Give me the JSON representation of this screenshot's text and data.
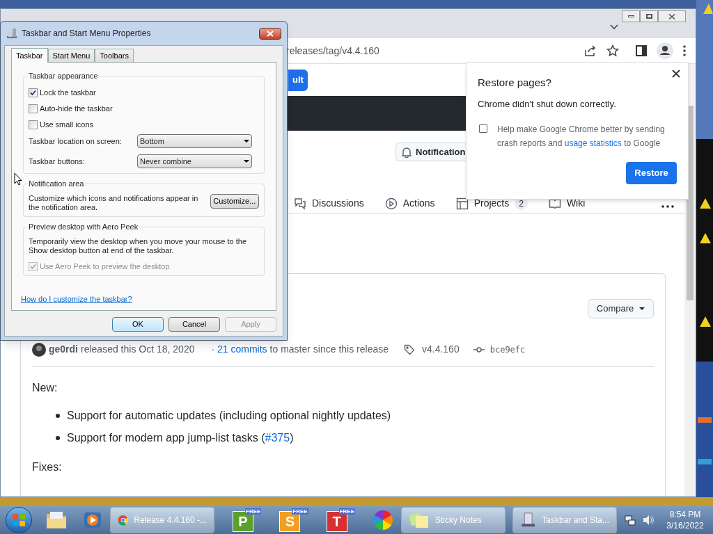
{
  "browser": {
    "address": "releases/tag/v4.4.160",
    "page": {
      "partial_button": "ult",
      "notification_button": "Notification",
      "nav": [
        {
          "label": "Discussions",
          "kind": "discussions"
        },
        {
          "label": "Actions",
          "kind": "actions"
        },
        {
          "label": "Projects",
          "kind": "projects",
          "count": "2"
        },
        {
          "label": "Wiki",
          "kind": "wiki"
        }
      ],
      "compare_button": "Compare",
      "release": {
        "author": "ge0rdi",
        "released": "released this Oct 18, 2020",
        "commits_link": "· 21 commits",
        "commits_rest": "to master since this release",
        "tag": "v4.4.160",
        "commit": "bce9efc",
        "sections": [
          {
            "heading": "New:",
            "items": [
              {
                "text": "Support for automatic updates (including optional nightly updates)"
              },
              {
                "text": "Support for modern app jump-list tasks (",
                "link": "#375",
                "after": ")"
              }
            ]
          },
          {
            "heading": "Fixes:"
          }
        ]
      }
    },
    "restore_popup": {
      "title": "Restore pages?",
      "message": "Chrome didn't shut down correctly.",
      "checkbox": {
        "checked": false,
        "text": "Help make Google Chrome better by sending crash reports and",
        "link": "usage statistics",
        "after": "to Google"
      },
      "button": "Restore"
    }
  },
  "dialog": {
    "title": "Taskbar and Start Menu Properties",
    "tabs": [
      {
        "label": "Taskbar",
        "selected": true
      },
      {
        "label": "Start Menu",
        "selected": false
      },
      {
        "label": "Toolbars",
        "selected": false
      }
    ],
    "appearance": {
      "title": "Taskbar appearance",
      "checkboxes": [
        {
          "label": "Lock the taskbar",
          "checked": true
        },
        {
          "label": "Auto-hide the taskbar",
          "checked": false
        },
        {
          "label": "Use small icons",
          "checked": false
        }
      ],
      "selects": [
        {
          "label": "Taskbar location on screen:",
          "value": "Bottom"
        },
        {
          "label": "Taskbar buttons:",
          "value": "Never combine"
        }
      ]
    },
    "notification": {
      "title": "Notification area",
      "text": "Customize which icons and notifications appear in the notification area.",
      "button": "Customize..."
    },
    "peek": {
      "title": "Preview desktop with Aero Peek",
      "text": "Temporarily view the desktop when you move your mouse to the Show desktop button at end of the taskbar.",
      "checkbox": {
        "label": "Use Aero Peek to preview the desktop",
        "checked": true,
        "disabled": true
      }
    },
    "help_link": "How do I customize the taskbar?",
    "buttons": [
      {
        "label": "OK",
        "disabled": false
      },
      {
        "label": "Cancel",
        "disabled": false
      },
      {
        "label": "Apply",
        "disabled": true
      }
    ]
  },
  "taskbar": {
    "items": [
      {
        "kind": "explorer"
      },
      {
        "kind": "media"
      },
      {
        "kind": "chrome-window",
        "label": "Release 4.4.160 -..."
      },
      {
        "kind": "letter",
        "letter": "P",
        "badge": "FREE",
        "color": "#5aa02c"
      },
      {
        "kind": "letter",
        "letter": "S",
        "badge": "FREE",
        "color": "#f0a020"
      },
      {
        "kind": "letter",
        "letter": "T",
        "badge": "FREE",
        "color": "#d83030"
      },
      {
        "kind": "pinwheel"
      },
      {
        "kind": "notes-window",
        "label": "Sticky Notes"
      },
      {
        "kind": "properties-window",
        "label": "Taskbar and Sta..."
      }
    ],
    "time": "8:54 PM",
    "date": "3/16/2022"
  }
}
